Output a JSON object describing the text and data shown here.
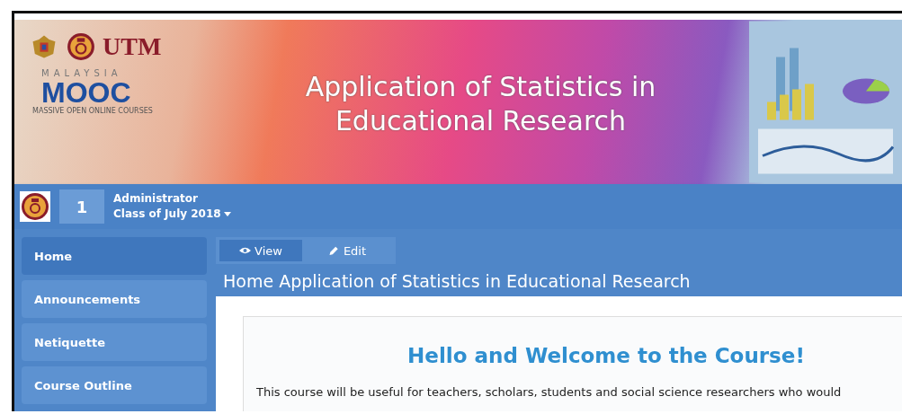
{
  "banner": {
    "logo_text": "UTM",
    "mooc_top": "MALAYSIA",
    "mooc_name": "MOOC",
    "mooc_sub": "MASSIVE OPEN ONLINE COURSES",
    "title": "Application of Statistics in Educational Research"
  },
  "user_bar": {
    "badge": "1",
    "name": "Administrator",
    "class_menu": "Class of July 2018"
  },
  "sidebar": {
    "items": [
      {
        "label": "Home",
        "selected": true
      },
      {
        "label": "Announcements",
        "selected": false
      },
      {
        "label": "Netiquette",
        "selected": false
      },
      {
        "label": "Course Outline",
        "selected": false
      }
    ]
  },
  "tabs": [
    {
      "label": "View",
      "kind": "eye",
      "selected": true
    },
    {
      "label": "Edit",
      "kind": "pencil",
      "selected": false
    }
  ],
  "page_title": "Home Application of Statistics in Educational Research",
  "content": {
    "heading": "Hello and Welcome to the Course!",
    "intro": "This course will be useful for teachers, scholars, students and social science researchers who would"
  }
}
